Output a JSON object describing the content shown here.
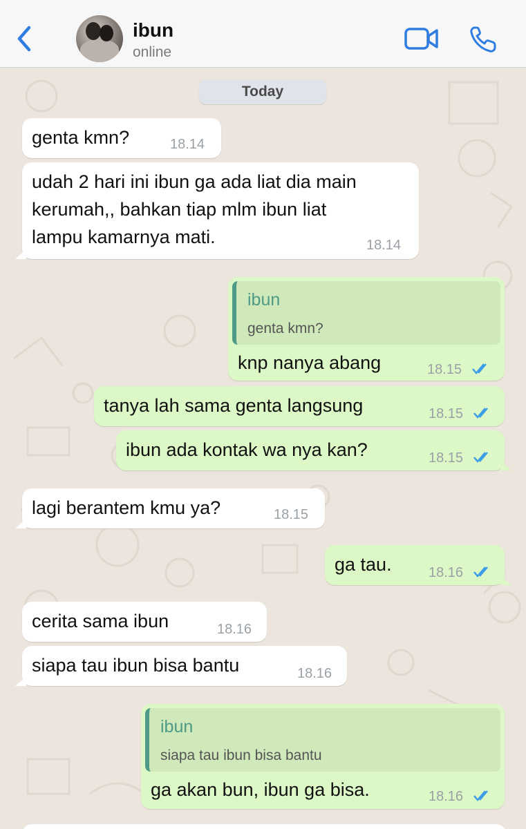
{
  "header": {
    "contact_name": "ibun",
    "status": "online"
  },
  "icons": {
    "back": "chevron-left-icon",
    "video": "video-camera-icon",
    "call": "phone-icon"
  },
  "colors": {
    "accent": "#2f7de1",
    "outgoing_bubble": "#dcf8c6",
    "incoming_bubble": "#ffffff",
    "quote_bar": "#4f9a87",
    "read_ticks": "#3a9be8"
  },
  "date_separator": "Today",
  "messages": [
    {
      "direction": "in",
      "text": "genta kmn?",
      "time": "18.14"
    },
    {
      "direction": "in",
      "text": "udah 2 hari ini ibun ga ada liat dia main\nkerumah,, bahkan tiap mlm ibun liat\nlampu kamarnya mati.",
      "time": "18.14"
    },
    {
      "direction": "out",
      "quote_name": "ibun",
      "quote_text": "genta kmn?",
      "text": "knp nanya abang",
      "time": "18.15",
      "read": true
    },
    {
      "direction": "out",
      "text": "tanya lah sama genta langsung",
      "time": "18.15",
      "read": true
    },
    {
      "direction": "out",
      "text": "ibun ada kontak wa nya kan?",
      "time": "18.15",
      "read": true
    },
    {
      "direction": "in",
      "text": "lagi berantem kmu ya?",
      "time": "18.15"
    },
    {
      "direction": "out",
      "text": "ga tau.",
      "time": "18.16",
      "read": true
    },
    {
      "direction": "in",
      "text": "cerita sama ibun",
      "time": "18.16"
    },
    {
      "direction": "in",
      "text": "siapa tau ibun bisa bantu",
      "time": "18.16"
    },
    {
      "direction": "out",
      "quote_name": "ibun",
      "quote_text": "siapa tau ibun bisa bantu",
      "text": "ga akan bun, ibun ga bisa.",
      "time": "18.16",
      "read": true
    }
  ]
}
